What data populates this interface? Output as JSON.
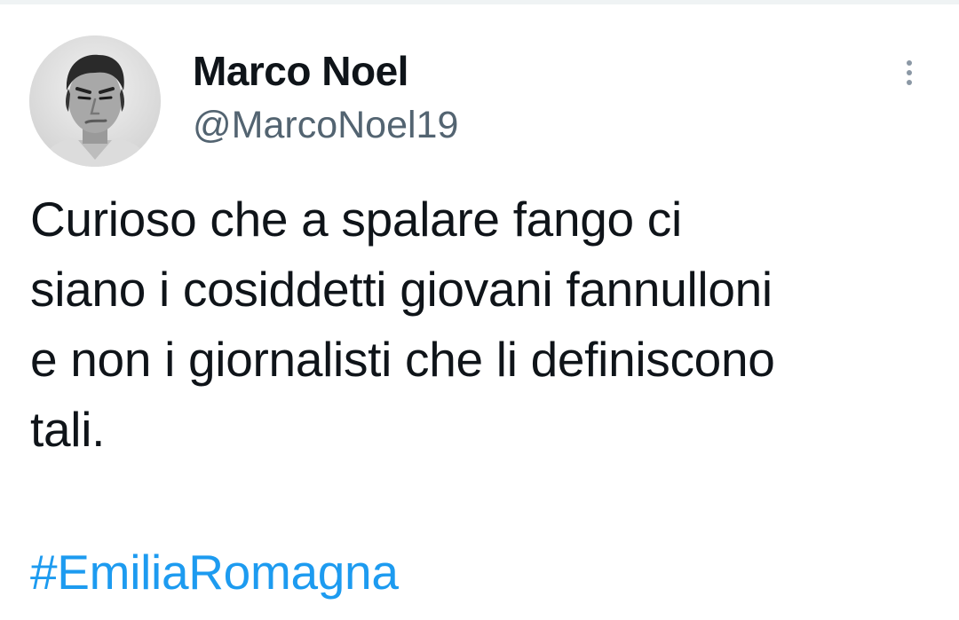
{
  "tweet": {
    "author": {
      "display_name": "Marco Noel",
      "handle": "@MarcoNoel19",
      "avatar_icon": "profile-photo"
    },
    "more_icon": "vertical-ellipsis-icon",
    "text_lines": [
      "Curioso che a spalare fango ci",
      "siano i cosiddetti giovani fannulloni",
      "e non i giornalisti che li definiscono",
      "tali."
    ],
    "hashtag": "#EmiliaRomagna"
  },
  "colors": {
    "text_primary": "#0f1419",
    "text_secondary": "#536471",
    "link": "#1d9bf0",
    "background": "#ffffff"
  }
}
